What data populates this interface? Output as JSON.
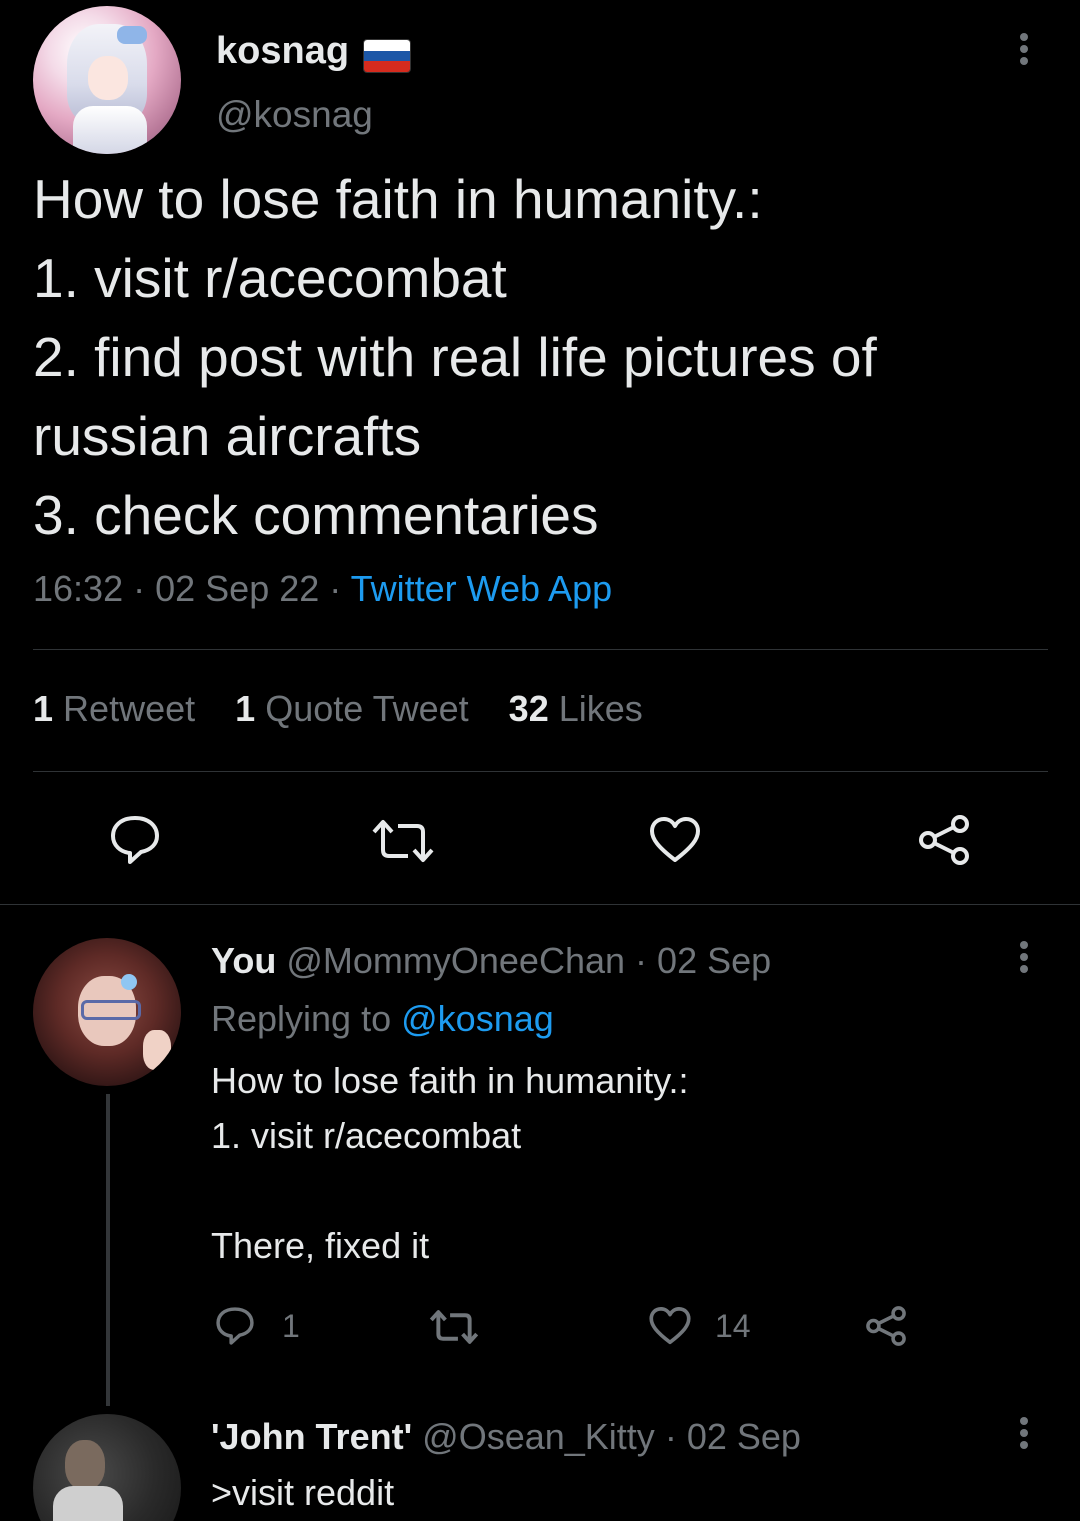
{
  "main_tweet": {
    "display_name": "kosnag",
    "handle": "@kosnag",
    "flag": "russia-flag",
    "lines": [
      "How to lose faith in humanity.:",
      "1. visit r/acecombat",
      "2. find post with real life pictures of",
      "russian aircrafts",
      "3. check commentaries"
    ],
    "time": "16:32",
    "date": "02 Sep 22",
    "sep": "·",
    "source": "Twitter Web App",
    "stats": {
      "retweets_count": "1",
      "retweets_label": "Retweet",
      "quotes_count": "1",
      "quotes_label": "Quote Tweet",
      "likes_count": "32",
      "likes_label": "Likes"
    }
  },
  "reply1": {
    "display_name": "You",
    "handle": "@MommyOneeChan",
    "date": "02 Sep",
    "sep": "·",
    "replying_prefix": "Replying to",
    "replying_to": "@kosnag",
    "lines": [
      "How to lose faith in humanity.:",
      "1. visit r/acecombat",
      "There, fixed it"
    ],
    "reply_count": "1",
    "like_count": "14"
  },
  "reply2": {
    "display_name": "'John Trent'",
    "handle": "@Osean_Kitty",
    "date": "02 Sep",
    "sep": "·",
    "text": ">visit reddit"
  },
  "colors": {
    "background": "#000000",
    "text": "#e7e9ea",
    "secondary": "#71767b",
    "accent": "#1d9bf0",
    "divider": "#2f3336"
  }
}
